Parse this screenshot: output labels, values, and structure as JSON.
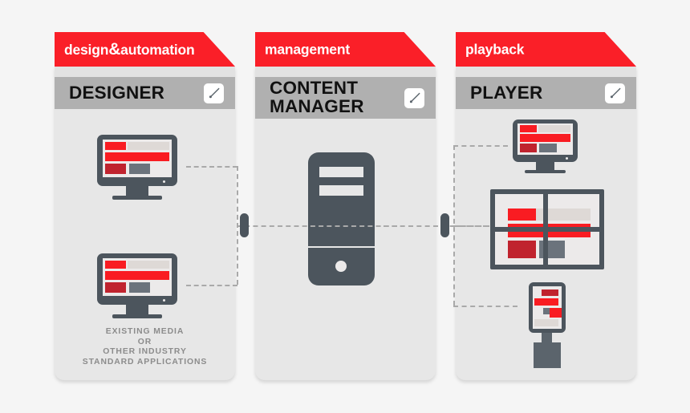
{
  "theme": {
    "background": "#f5f5f5",
    "ribbon_red": "#fa1f28",
    "panel_body": "#e7e7e7",
    "titlebar_gray": "#b0b0b0",
    "device_slate": "#4c555d",
    "screen_white": "#eceaea",
    "accent_red_bright": "#f91c22",
    "accent_red_dark": "#c0232e",
    "block_gray": "#6b737c",
    "block_light": "#ded9d6",
    "dash_gray": "#a9a9a9",
    "caption_gray": "#8c8c8c"
  },
  "panels": [
    {
      "id": "design-automation",
      "ribbon_label": "design&automation",
      "ribbon_pre": "design",
      "ribbon_amp": "&",
      "ribbon_post": "automation",
      "title": "DESIGNER",
      "edit_icon": "pencil-icon",
      "caption": "EXISTING MEDIA\nOR\nOTHER INDUSTRY\nSTANDARD APPLICATIONS"
    },
    {
      "id": "management",
      "ribbon_label": "management",
      "title": "CONTENT\nMANAGER",
      "edit_icon": "pencil-icon",
      "caption": ""
    },
    {
      "id": "playback",
      "ribbon_label": "playback",
      "title": "PLAYER",
      "edit_icon": "pencil-icon",
      "caption": ""
    }
  ],
  "devices": {
    "designer_monitor_top": "desktop-monitor",
    "designer_monitor_bottom": "desktop-monitor",
    "content_manager_server": "server-tower",
    "player_monitor": "desktop-monitor",
    "player_video_wall": "video-wall-2x2",
    "player_kiosk": "portrait-kiosk-display"
  },
  "connectors": {
    "left_pill": "connector-node",
    "right_pill": "connector-node",
    "line_style": "dashed"
  }
}
